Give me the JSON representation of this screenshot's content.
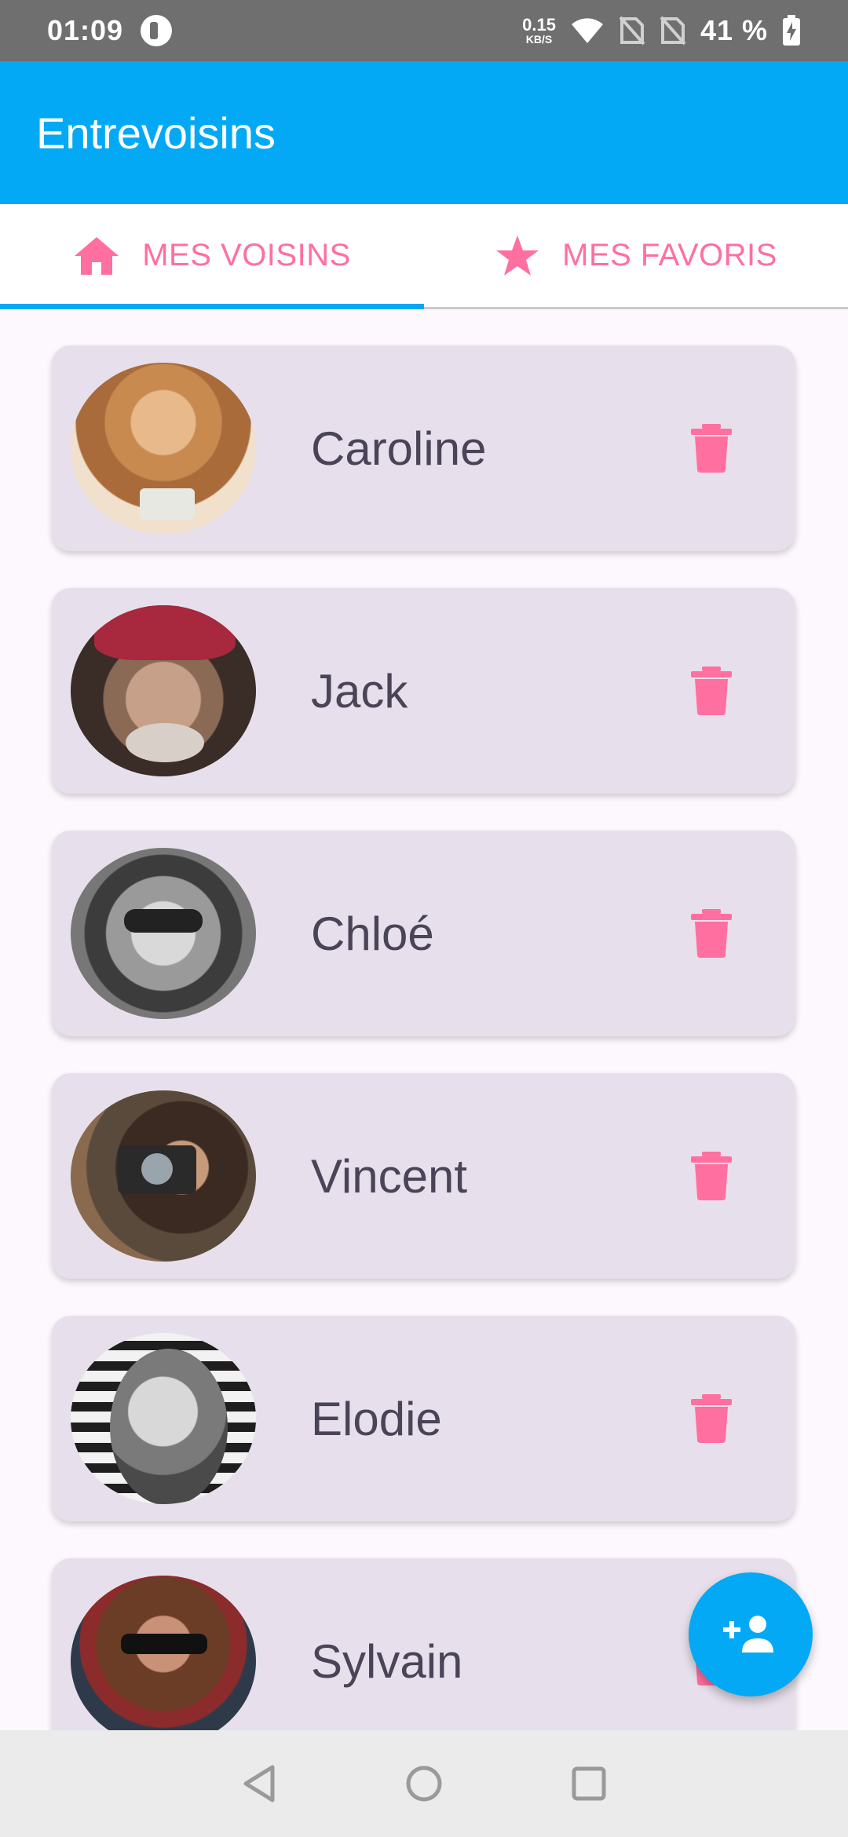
{
  "status_bar": {
    "time": "01:09",
    "speed_value": "0.15",
    "speed_unit": "KB/S",
    "battery_text": "41 %"
  },
  "app_bar": {
    "title": "Entrevoisins"
  },
  "tabs": [
    {
      "label": "MES VOISINS",
      "icon": "home-icon",
      "active": true
    },
    {
      "label": "MES FAVORIS",
      "icon": "star-icon",
      "active": false
    }
  ],
  "neighbours": [
    {
      "name": "Caroline"
    },
    {
      "name": "Jack"
    },
    {
      "name": "Chloé"
    },
    {
      "name": "Vincent"
    },
    {
      "name": "Elodie"
    },
    {
      "name": "Sylvain"
    }
  ],
  "fab": {
    "icon": "add-person-icon"
  },
  "nav_bar": {
    "buttons": [
      "back-icon",
      "home-circle-icon",
      "recents-icon"
    ]
  },
  "colors": {
    "primary": "#03a9f4",
    "accent": "#ff6fa0",
    "card": "#e7e0ec",
    "status_bar": "#6f6f6f",
    "name_text": "#4a4458"
  }
}
